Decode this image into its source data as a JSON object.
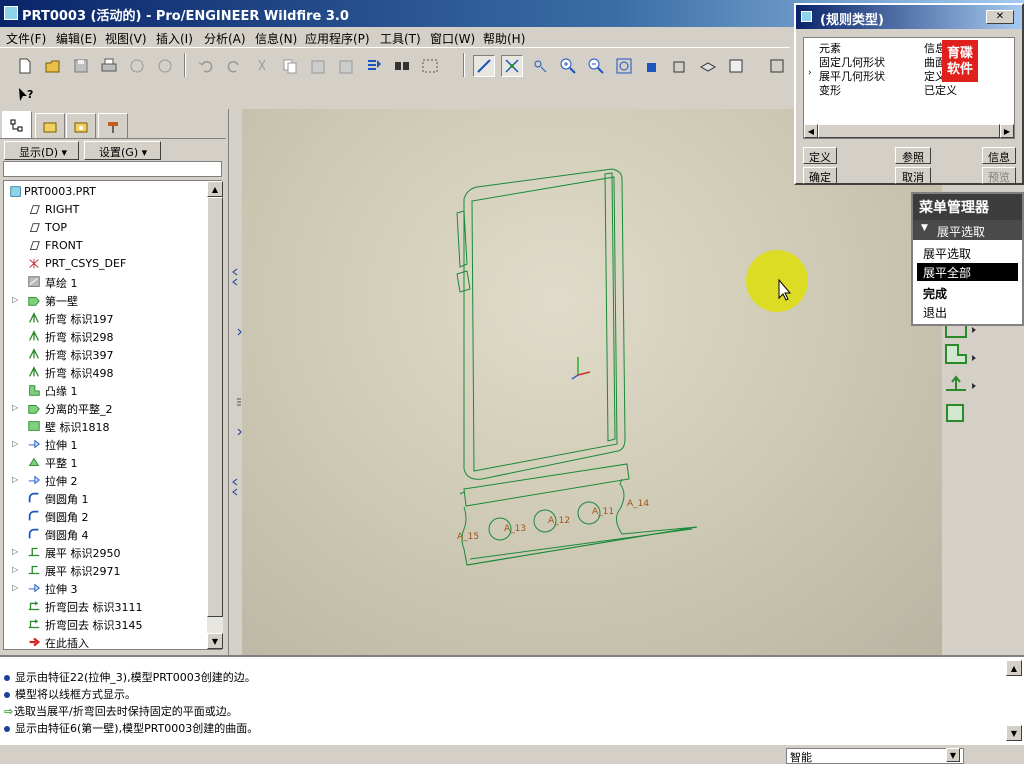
{
  "window": {
    "title": "PRT0003 (活动的) - Pro/ENGINEER Wildfire 3.0"
  },
  "menu": [
    "文件(F)",
    "编辑(E)",
    "视图(V)",
    "插入(I)",
    "分析(A)",
    "信息(N)",
    "应用程序(P)",
    "工具(T)",
    "窗口(W)",
    "帮助(H)"
  ],
  "nav": {
    "show_label": "显示(D)",
    "settings_label": "设置(G)"
  },
  "tree": [
    {
      "label": "PRT0003.PRT",
      "icon": "part-icon",
      "exp": false
    },
    {
      "label": "RIGHT",
      "icon": "datum-plane-icon",
      "exp": false
    },
    {
      "label": "TOP",
      "icon": "datum-plane-icon",
      "exp": false
    },
    {
      "label": "FRONT",
      "icon": "datum-plane-icon",
      "exp": false
    },
    {
      "label": "PRT_CSYS_DEF",
      "icon": "csys-icon",
      "exp": false
    },
    {
      "label": "草绘 1",
      "icon": "sketch-icon",
      "exp": false
    },
    {
      "label": "第一壁",
      "icon": "wall-icon",
      "exp": true
    },
    {
      "label": "折弯 标识197",
      "icon": "bend-icon",
      "exp": false
    },
    {
      "label": "折弯 标识298",
      "icon": "bend-icon",
      "exp": false
    },
    {
      "label": "折弯 标识397",
      "icon": "bend-icon",
      "exp": false
    },
    {
      "label": "折弯 标识498",
      "icon": "bend-icon",
      "exp": false
    },
    {
      "label": "凸缘 1",
      "icon": "flange-icon",
      "exp": false
    },
    {
      "label": "分离的平整_2",
      "icon": "wall-icon",
      "exp": true
    },
    {
      "label": "壁 标识1818",
      "icon": "flat-wall-icon",
      "exp": false
    },
    {
      "label": "拉伸 1",
      "icon": "extrude-icon",
      "exp": true
    },
    {
      "label": "平整 1",
      "icon": "flat-icon",
      "exp": false
    },
    {
      "label": "拉伸 2",
      "icon": "extrude-icon",
      "exp": true
    },
    {
      "label": "倒圆角 1",
      "icon": "round-icon",
      "exp": false
    },
    {
      "label": "倒圆角 2",
      "icon": "round-icon",
      "exp": false
    },
    {
      "label": "倒圆角 4",
      "icon": "round-icon",
      "exp": false
    },
    {
      "label": "展平 标识2950",
      "icon": "unbend-icon",
      "exp": true
    },
    {
      "label": "展平 标识2971",
      "icon": "unbend-icon",
      "exp": true
    },
    {
      "label": "拉伸 3",
      "icon": "extrude-icon",
      "exp": true
    },
    {
      "label": "折弯回去 标识3111",
      "icon": "bendback-icon",
      "exp": false
    },
    {
      "label": "折弯回去 标识3145",
      "icon": "bendback-icon",
      "exp": false
    },
    {
      "label": "在此插入",
      "icon": "insert-arrow-icon",
      "exp": false
    }
  ],
  "messages": [
    "显示由特征22(拉伸_3),模型PRT0003创建的边。",
    "模型将以线框方式显示。",
    "选取当展平/折弯回去时保持固定的平面或边。",
    "显示由特征6(第一壁),模型PRT0003创建的曲面。"
  ],
  "status": {
    "filter": "智能"
  },
  "dialog": {
    "title": "(规则类型)",
    "rows": [
      {
        "element": "元素",
        "info": "信息"
      },
      {
        "element": "固定几何形状",
        "info": "曲面 1"
      },
      {
        "element": "展平几何形状",
        "info": "定义"
      },
      {
        "element": "变形",
        "info": "已定义"
      }
    ],
    "buttons": {
      "define": "定义",
      "refs": "参照",
      "info": "信息",
      "ok": "确定",
      "cancel": "取消",
      "preview": "预览"
    }
  },
  "watermark": {
    "line1": "育碟",
    "line2": "软件"
  },
  "menu_manager": {
    "title": "菜单管理器",
    "subtitle": "展平选取",
    "items": [
      "展平选取",
      "展平全部",
      "完成",
      "退出"
    ]
  },
  "model_labels": [
    "A_15",
    "A_13",
    "A_12",
    "A_11",
    "A_14"
  ]
}
